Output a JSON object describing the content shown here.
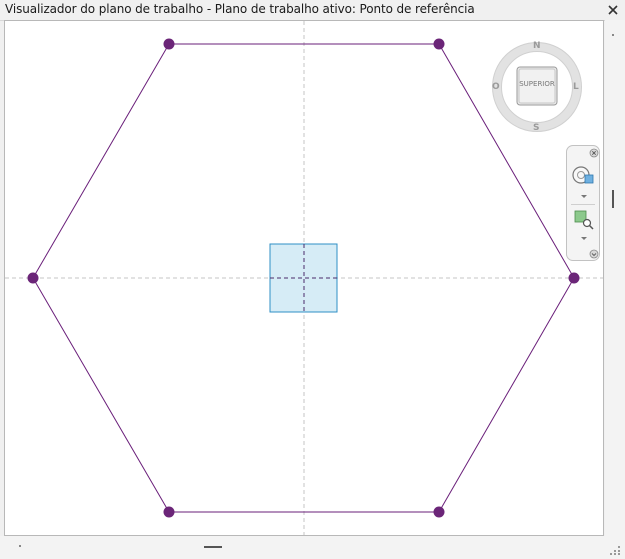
{
  "window": {
    "title": "Visualizador do plano de trabalho - Plano de trabalho ativo: Ponto de referência"
  },
  "viewcube": {
    "face_label": "SUPERIOR",
    "compass": {
      "north": "N",
      "south": "S",
      "east": "L",
      "west": "O"
    }
  },
  "colors": {
    "shape_stroke": "#6a1f7a",
    "vertex": "#6b2578",
    "workplane_fill": "#d6ecf6",
    "workplane_stroke": "#2f8fc5",
    "axis": "#bdbdbd"
  },
  "icons": {
    "close": "close-icon",
    "nav_close": "close-small-icon",
    "orbit": "orbit-icon",
    "zoom": "zoom-region-icon",
    "nav_options": "options-icon"
  }
}
